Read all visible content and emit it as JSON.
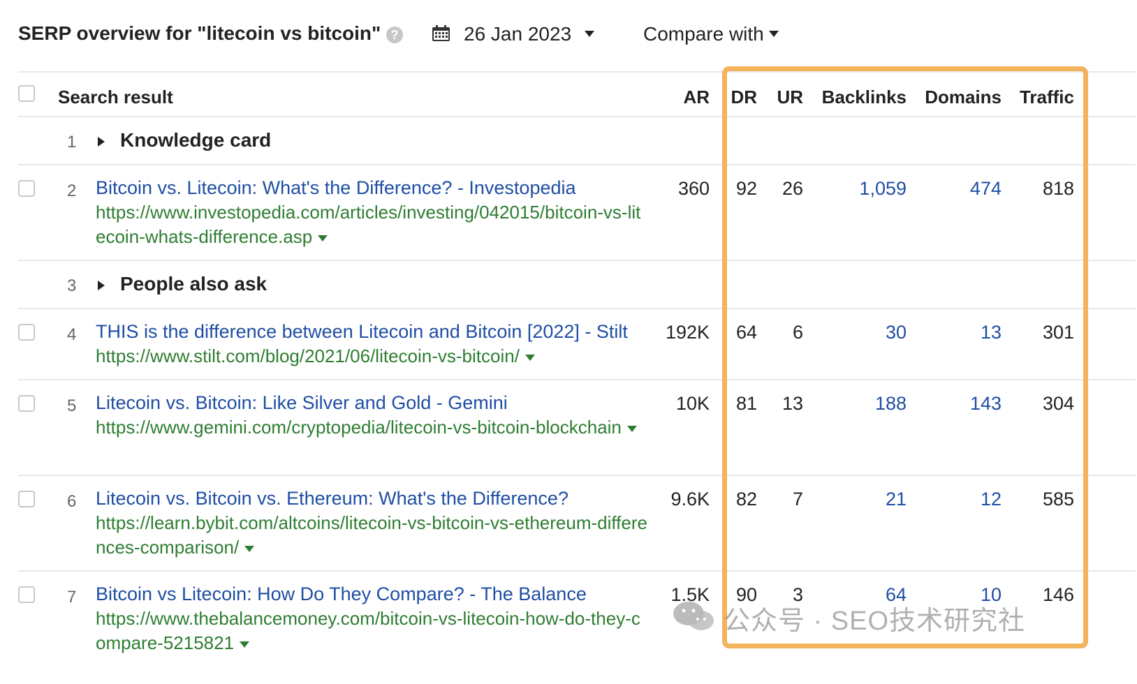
{
  "header": {
    "title": "SERP overview for \"litecoin vs bitcoin\"",
    "help_icon": "question-circle-icon",
    "date": "26 Jan 2023",
    "compare_label": "Compare with"
  },
  "table": {
    "columns": [
      "Search result",
      "AR",
      "DR",
      "UR",
      "Backlinks",
      "Domains",
      "Traffic"
    ],
    "rows": [
      {
        "pos": "1",
        "type": "group",
        "label": "Knowledge card"
      },
      {
        "pos": "2",
        "type": "result",
        "title": "Bitcoin vs. Litecoin: What's the Difference? - Investopedia",
        "url": "https://www.investopedia.com/articles/investing/042015/bitcoin-vs-litecoin-whats-difference.asp",
        "ar": "360",
        "dr": "92",
        "ur": "26",
        "backlinks": "1,059",
        "domains": "474",
        "traffic": "818"
      },
      {
        "pos": "3",
        "type": "group",
        "label": "People also ask"
      },
      {
        "pos": "4",
        "type": "result",
        "title": "THIS is the difference between Litecoin and Bitcoin [2022] - Stilt",
        "url": "https://www.stilt.com/blog/2021/06/litecoin-vs-bitcoin/",
        "ar": "192K",
        "dr": "64",
        "ur": "6",
        "backlinks": "30",
        "domains": "13",
        "traffic": "301"
      },
      {
        "pos": "5",
        "type": "result",
        "title": "Litecoin vs. Bitcoin: Like Silver and Gold - Gemini",
        "url": "https://www.gemini.com/cryptopedia/litecoin-vs-bitcoin-blockchain",
        "ar": "10K",
        "dr": "81",
        "ur": "13",
        "backlinks": "188",
        "domains": "143",
        "traffic": "304"
      },
      {
        "pos": "6",
        "type": "result",
        "title": "Litecoin vs. Bitcoin vs. Ethereum: What's the Difference?",
        "url": "https://learn.bybit.com/altcoins/litecoin-vs-bitcoin-vs-ethereum-differences-comparison/",
        "ar": "9.6K",
        "dr": "82",
        "ur": "7",
        "backlinks": "21",
        "domains": "12",
        "traffic": "585"
      },
      {
        "pos": "7",
        "type": "result",
        "title": "Bitcoin vs Litecoin: How Do They Compare? - The Balance",
        "url": "https://www.thebalancemoney.com/bitcoin-vs-litecoin-how-do-they-compare-5215821",
        "ar": "1.5K",
        "dr": "90",
        "ur": "3",
        "backlinks": "64",
        "domains": "10",
        "traffic": "146"
      }
    ]
  },
  "watermark": {
    "text": "公众号 · SEO技术研究社",
    "icon": "wechat-icon"
  },
  "colors": {
    "link": "#1f4ea3",
    "url": "#2e7d32",
    "highlight": "#f3b25c"
  }
}
